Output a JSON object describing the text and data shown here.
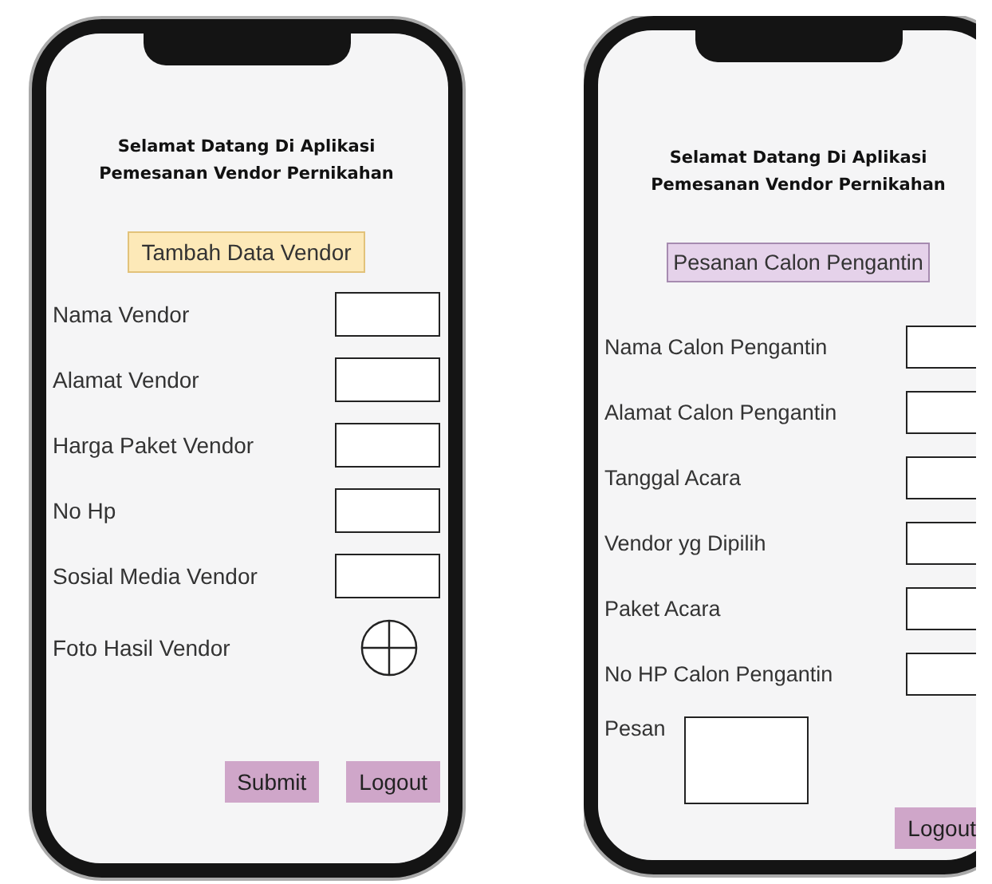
{
  "screens": [
    {
      "title": "Selamat Datang Di Aplikasi\nPemesanan Vendor Pernikahan",
      "heading": {
        "label": "Tambah Data Vendor",
        "kind": "add"
      },
      "fields": [
        {
          "label": "Nama Vendor",
          "kind": "input"
        },
        {
          "label": "Alamat Vendor",
          "kind": "input"
        },
        {
          "label": "Harga Paket Vendor",
          "kind": "input"
        },
        {
          "label": "No Hp",
          "kind": "input"
        },
        {
          "label": "Sosial Media Vendor",
          "kind": "input"
        },
        {
          "label": "Foto Hasil Vendor",
          "kind": "upload"
        }
      ],
      "buttons": [
        "Submit",
        "Logout"
      ]
    },
    {
      "title": "Selamat Datang Di Aplikasi\nPemesanan Vendor Pernikahan",
      "heading": {
        "label": "Pesanan Calon Pengantin",
        "kind": "order"
      },
      "fields": [
        {
          "label": "Nama Calon Pengantin",
          "kind": "input"
        },
        {
          "label": "Alamat Calon Pengantin",
          "kind": "input"
        },
        {
          "label": "Tanggal Acara",
          "kind": "input"
        },
        {
          "label": "Vendor yg Dipilih",
          "kind": "input"
        },
        {
          "label": "Paket Acara",
          "kind": "input"
        },
        {
          "label": "No HP Calon Pengantin",
          "kind": "input"
        },
        {
          "label": "Pesan",
          "kind": "textarea"
        }
      ],
      "buttons": [
        "Logout"
      ]
    }
  ]
}
